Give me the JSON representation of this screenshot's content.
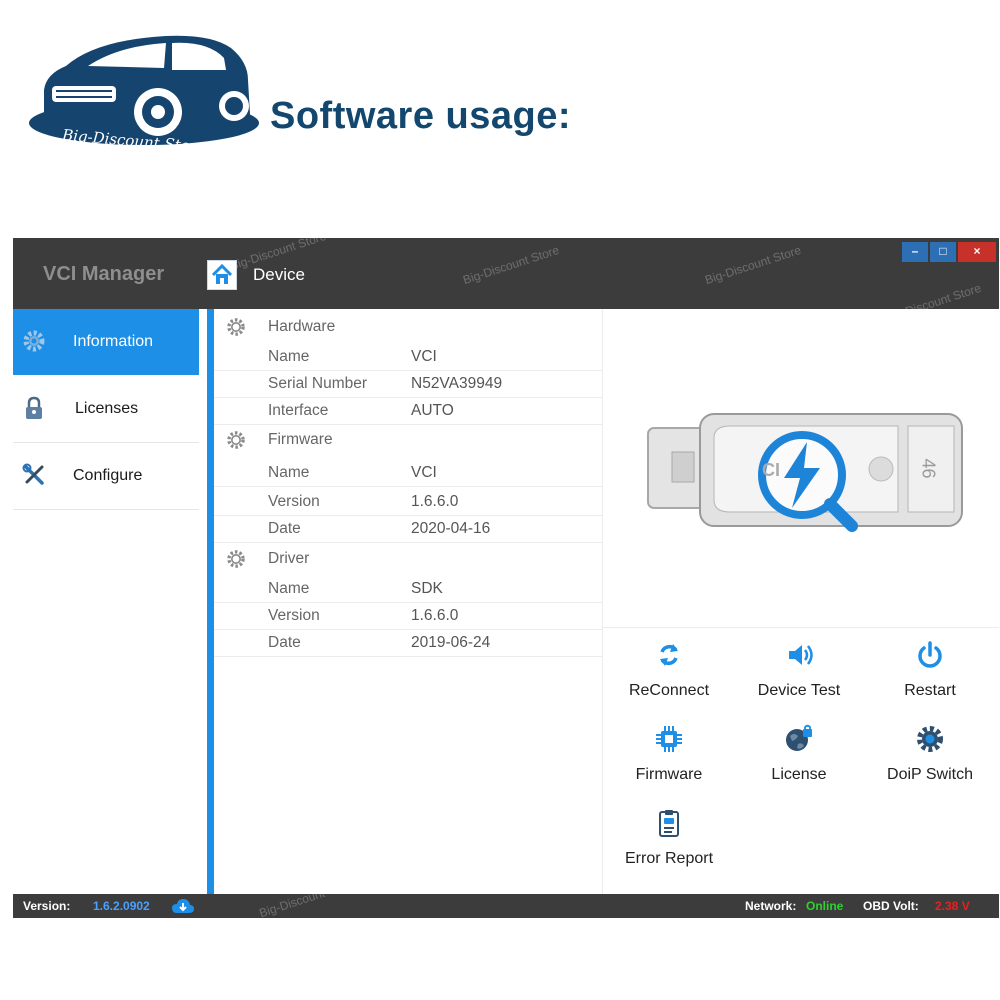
{
  "banner": {
    "logo_text": "Big-Discount Store",
    "headline": "Software usage:"
  },
  "window": {
    "app_title": "VCI Manager",
    "breadcrumb": "Device",
    "controls": {
      "minimize": "–",
      "maximize": "□",
      "close": "×"
    }
  },
  "sidebar": {
    "items": [
      {
        "label": "Information",
        "icon": "gear-icon",
        "active": true
      },
      {
        "label": "Licenses",
        "icon": "lock-icon",
        "active": false
      },
      {
        "label": "Configure",
        "icon": "tools-icon",
        "active": false
      }
    ]
  },
  "info": {
    "hardware": {
      "title": "Hardware",
      "rows": [
        {
          "key": "Name",
          "value": "VCI"
        },
        {
          "key": "Serial Number",
          "value": "N52VA39949"
        },
        {
          "key": "Interface",
          "value": "AUTO"
        }
      ]
    },
    "firmware": {
      "title": "Firmware",
      "rows": [
        {
          "key": "Name",
          "value": "VCI"
        },
        {
          "key": "Version",
          "value": "1.6.6.0"
        },
        {
          "key": "Date",
          "value": "2020-04-16"
        }
      ]
    },
    "driver": {
      "title": "Driver",
      "rows": [
        {
          "key": "Name",
          "value": "SDK"
        },
        {
          "key": "Version",
          "value": "1.6.6.0"
        },
        {
          "key": "Date",
          "value": "2019-06-24"
        }
      ]
    }
  },
  "device_image": {
    "label_left": "CI",
    "label_right": "46"
  },
  "actions": [
    {
      "label": "ReConnect",
      "icon": "reconnect-icon"
    },
    {
      "label": "Device Test",
      "icon": "speaker-icon"
    },
    {
      "label": "Restart",
      "icon": "power-icon"
    },
    {
      "label": "Firmware",
      "icon": "chip-icon"
    },
    {
      "label": "License",
      "icon": "globe-lock-icon"
    },
    {
      "label": "DoiP Switch",
      "icon": "gear-icon"
    },
    {
      "label": "Error Report",
      "icon": "clipboard-icon"
    }
  ],
  "statusbar": {
    "version_label": "Version:",
    "version_value": "1.6.2.0902",
    "network_label": "Network:",
    "network_value": "Online",
    "obd_label": "OBD Volt:",
    "obd_value": "2.38 V"
  },
  "watermarks": [
    "Big-Discount Store",
    "Big-Discount Store",
    "Big-Discount Store",
    "Big-Discount Store",
    "Big-Discount Store",
    "Big-Discount"
  ],
  "colors": {
    "accent": "#1d8fe6",
    "titlebar": "#3c3c3c",
    "headline": "#13476e",
    "online": "#2fd12f",
    "volt": "#e82020",
    "version": "#4aa0ff"
  }
}
